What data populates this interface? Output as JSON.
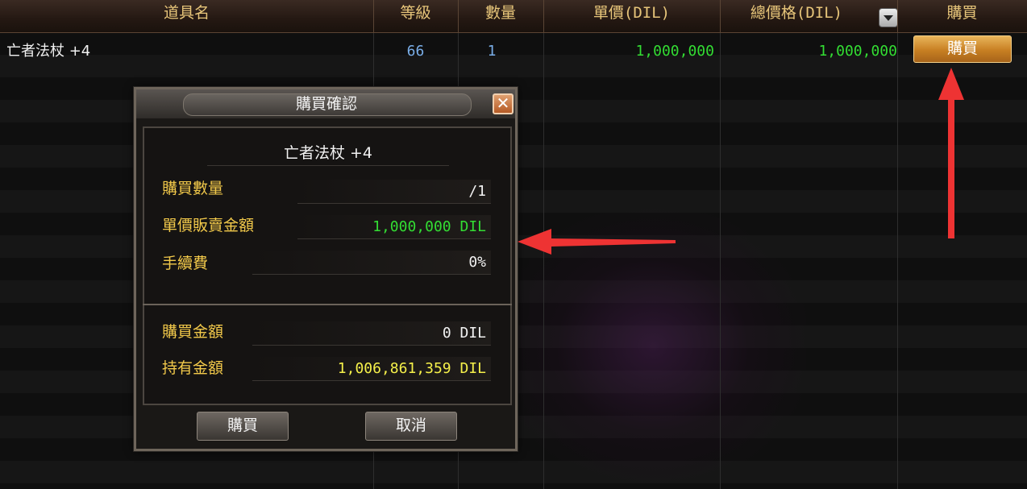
{
  "header": {
    "col_item_name": "道具名",
    "col_level": "等級",
    "col_quantity": "數量",
    "col_unit_price": "單價(DIL)",
    "col_total_price": "總價格(DIL)",
    "col_buy": "購買",
    "sort_icon": "chevron-down-icon"
  },
  "row": {
    "item_name": "亡者法杖 +4",
    "level": "66",
    "quantity": "1",
    "unit_price": "1,000,000",
    "total_price": "1,000,000",
    "buy_label": "購買"
  },
  "dialog": {
    "title": "購買確認",
    "item_name": "亡者法杖 +4",
    "qty_label": "購買數量",
    "qty_value": "/1",
    "unit_price_label": "單價販賣金額",
    "unit_price_value": "1,000,000 DIL",
    "fee_label": "手續費",
    "fee_value": "0%",
    "purchase_amount_label": "購買金額",
    "purchase_amount_value": "0 DIL",
    "held_amount_label": "持有金額",
    "held_amount_value": "1,006,861,359 DIL",
    "buy_button": "購買",
    "cancel_button": "取消"
  },
  "colors": {
    "header_text": "#e8c67a",
    "label_gold": "#f2c94a",
    "value_green": "#33dd33",
    "value_yellow": "#f5f04a",
    "level_blue": "#7aaee8",
    "buy_button": "#d08a2c",
    "arrow_red": "#ee3333"
  }
}
